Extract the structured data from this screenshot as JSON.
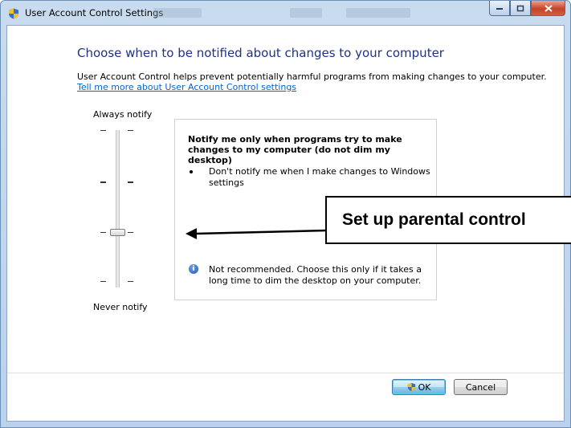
{
  "window": {
    "title": "User Account Control Settings"
  },
  "page": {
    "heading": "Choose when to be notified about changes to your computer",
    "description": "User Account Control helps prevent potentially harmful programs from making changes to your computer.",
    "link": "Tell me more about User Account Control settings"
  },
  "slider": {
    "top_label": "Always notify",
    "bottom_label": "Never notify",
    "levels": 4,
    "selected_level": 2
  },
  "panel": {
    "title": "Notify me only when programs try to make changes to my computer (do not dim my desktop)",
    "bullet": "Don't notify me when I make changes to Windows settings",
    "info": "Not recommended. Choose this only if it takes a long time to dim the desktop on your computer."
  },
  "buttons": {
    "ok": "OK",
    "cancel": "Cancel"
  },
  "annotation": {
    "callout": "Set up parental control"
  },
  "colors": {
    "heading": "#1e3287",
    "link": "#0066cc"
  }
}
